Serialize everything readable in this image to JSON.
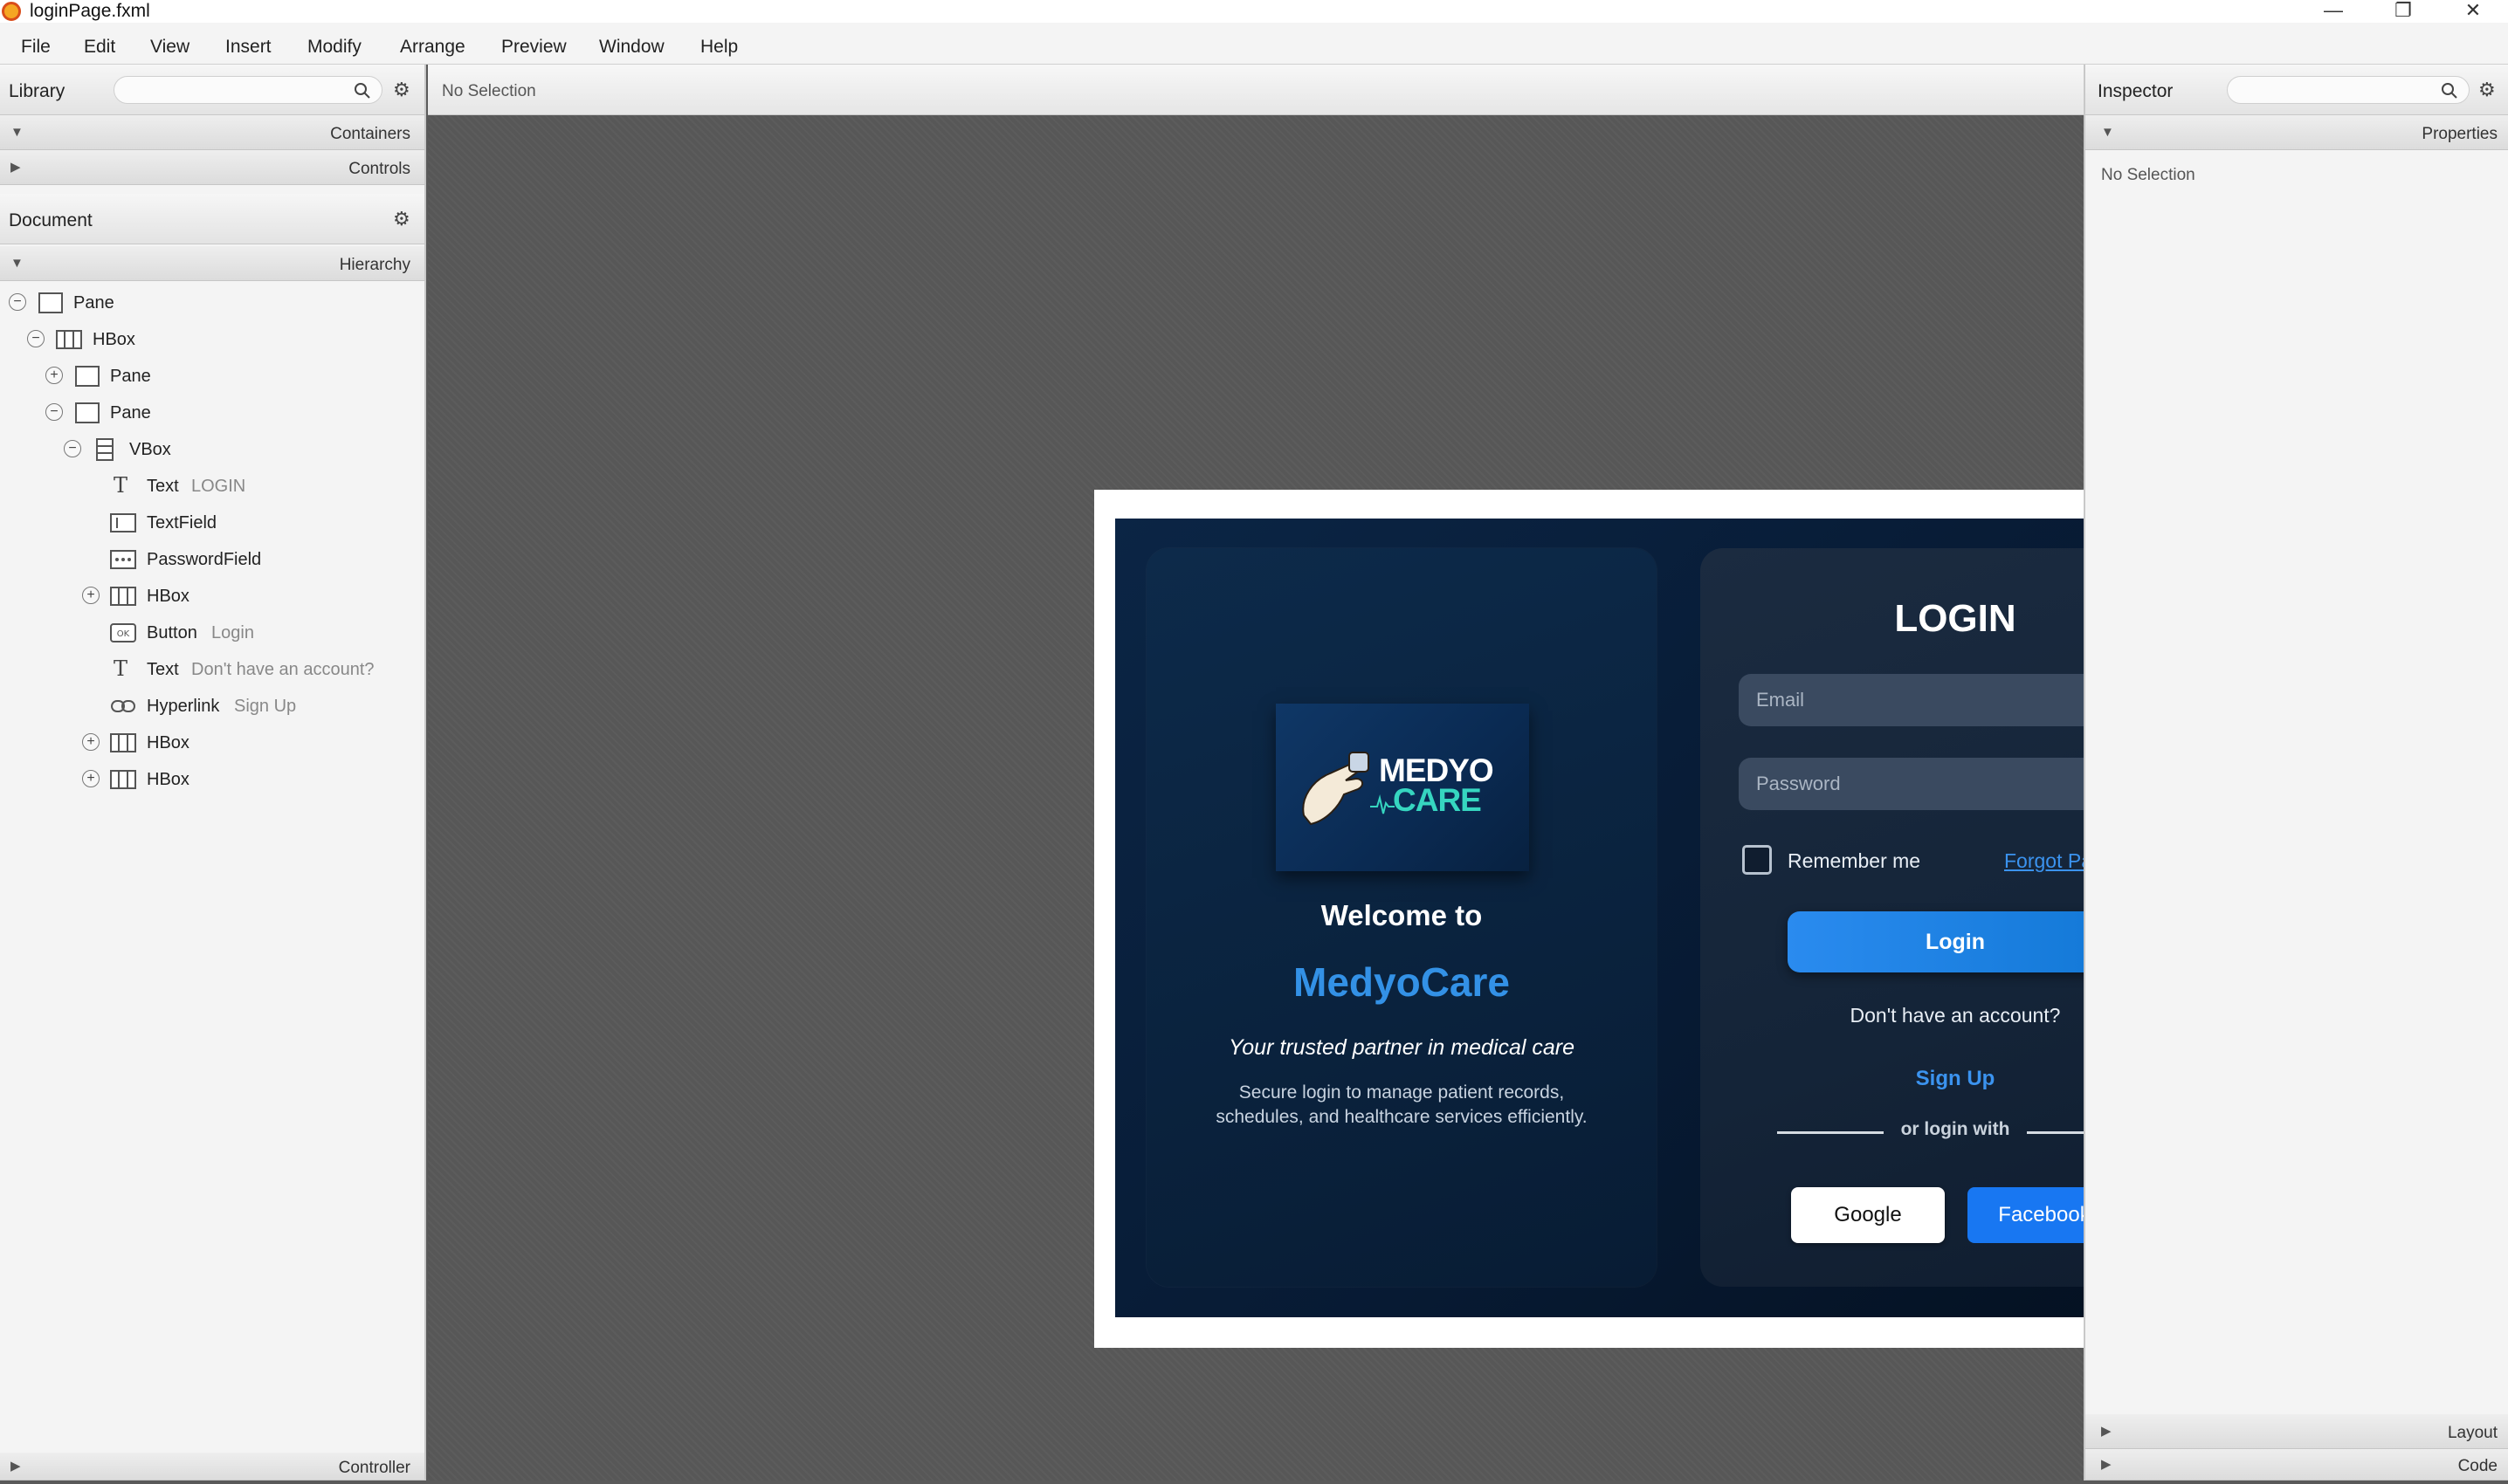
{
  "window": {
    "title": "loginPage.fxml",
    "minimize_icon": "minimize-icon",
    "maximize_icon": "restore-icon",
    "close_icon": "close-icon",
    "minimize_glyph": "—",
    "restore_glyph": "❐",
    "close_glyph": "✕"
  },
  "menu": [
    "File",
    "Edit",
    "View",
    "Insert",
    "Modify",
    "Arrange",
    "Preview",
    "Window",
    "Help"
  ],
  "library": {
    "title": "Library",
    "sections": [
      "Containers",
      "Controls"
    ]
  },
  "document": {
    "title": "Document",
    "section": "Hierarchy",
    "tree": [
      {
        "name": "Pane",
        "detail": "",
        "toggle": "−",
        "icon": "pane-icon"
      },
      {
        "name": "HBox",
        "detail": "",
        "toggle": "−",
        "icon": "hbox-icon"
      },
      {
        "name": "Pane",
        "detail": "",
        "toggle": "+",
        "icon": "pane-icon"
      },
      {
        "name": "Pane",
        "detail": "",
        "toggle": "−",
        "icon": "pane-icon"
      },
      {
        "name": "VBox",
        "detail": "",
        "toggle": "−",
        "icon": "vbox-icon"
      },
      {
        "name": "Text",
        "detail": "LOGIN",
        "toggle": "",
        "icon": "text-icon"
      },
      {
        "name": "TextField",
        "detail": "",
        "toggle": "",
        "icon": "textfield-icon"
      },
      {
        "name": "PasswordField",
        "detail": "",
        "toggle": "",
        "icon": "passwordfield-icon"
      },
      {
        "name": "HBox",
        "detail": "",
        "toggle": "+",
        "icon": "hbox-icon"
      },
      {
        "name": "Button",
        "detail": "Login",
        "toggle": "",
        "icon": "button-icon"
      },
      {
        "name": "Text",
        "detail": "Don't have an account?",
        "toggle": "",
        "icon": "text-icon"
      },
      {
        "name": "Hyperlink",
        "detail": "Sign Up",
        "toggle": "",
        "icon": "hyperlink-icon"
      },
      {
        "name": "HBox",
        "detail": "",
        "toggle": "+",
        "icon": "hbox-icon"
      },
      {
        "name": "HBox",
        "detail": "",
        "toggle": "+",
        "icon": "hbox-icon"
      }
    ],
    "footer": "Controller"
  },
  "center": {
    "selection": "No Selection"
  },
  "inspector": {
    "title": "Inspector",
    "section": "Properties",
    "empty": "No Selection",
    "footer_sections": [
      "Layout",
      "Code"
    ]
  },
  "preview": {
    "logo_top": "MEDYO",
    "logo_bottom": "CARE",
    "welcome": "Welcome to",
    "brand": "MedyoCare",
    "tagline": "Your trusted partner in medical care",
    "desc_line1": "Secure login to manage patient records,",
    "desc_line2": "schedules, and healthcare services efficiently.",
    "login_title": "LOGIN",
    "email_placeholder": "Email",
    "password_placeholder": "Password",
    "remember": "Remember me",
    "forgot": "Forgot Password?",
    "login_button": "Login",
    "no_account": "Don't have an account?",
    "signup": "Sign Up",
    "or_login_with": "or login with",
    "google": "Google",
    "facebook": "Facebook"
  },
  "colors": {
    "accent_blue": "#2a8bef",
    "brand_blue": "#3391e6",
    "facebook_blue": "#1877f2",
    "logo_teal": "#36d6c0",
    "scene_dark": "#071a33"
  }
}
